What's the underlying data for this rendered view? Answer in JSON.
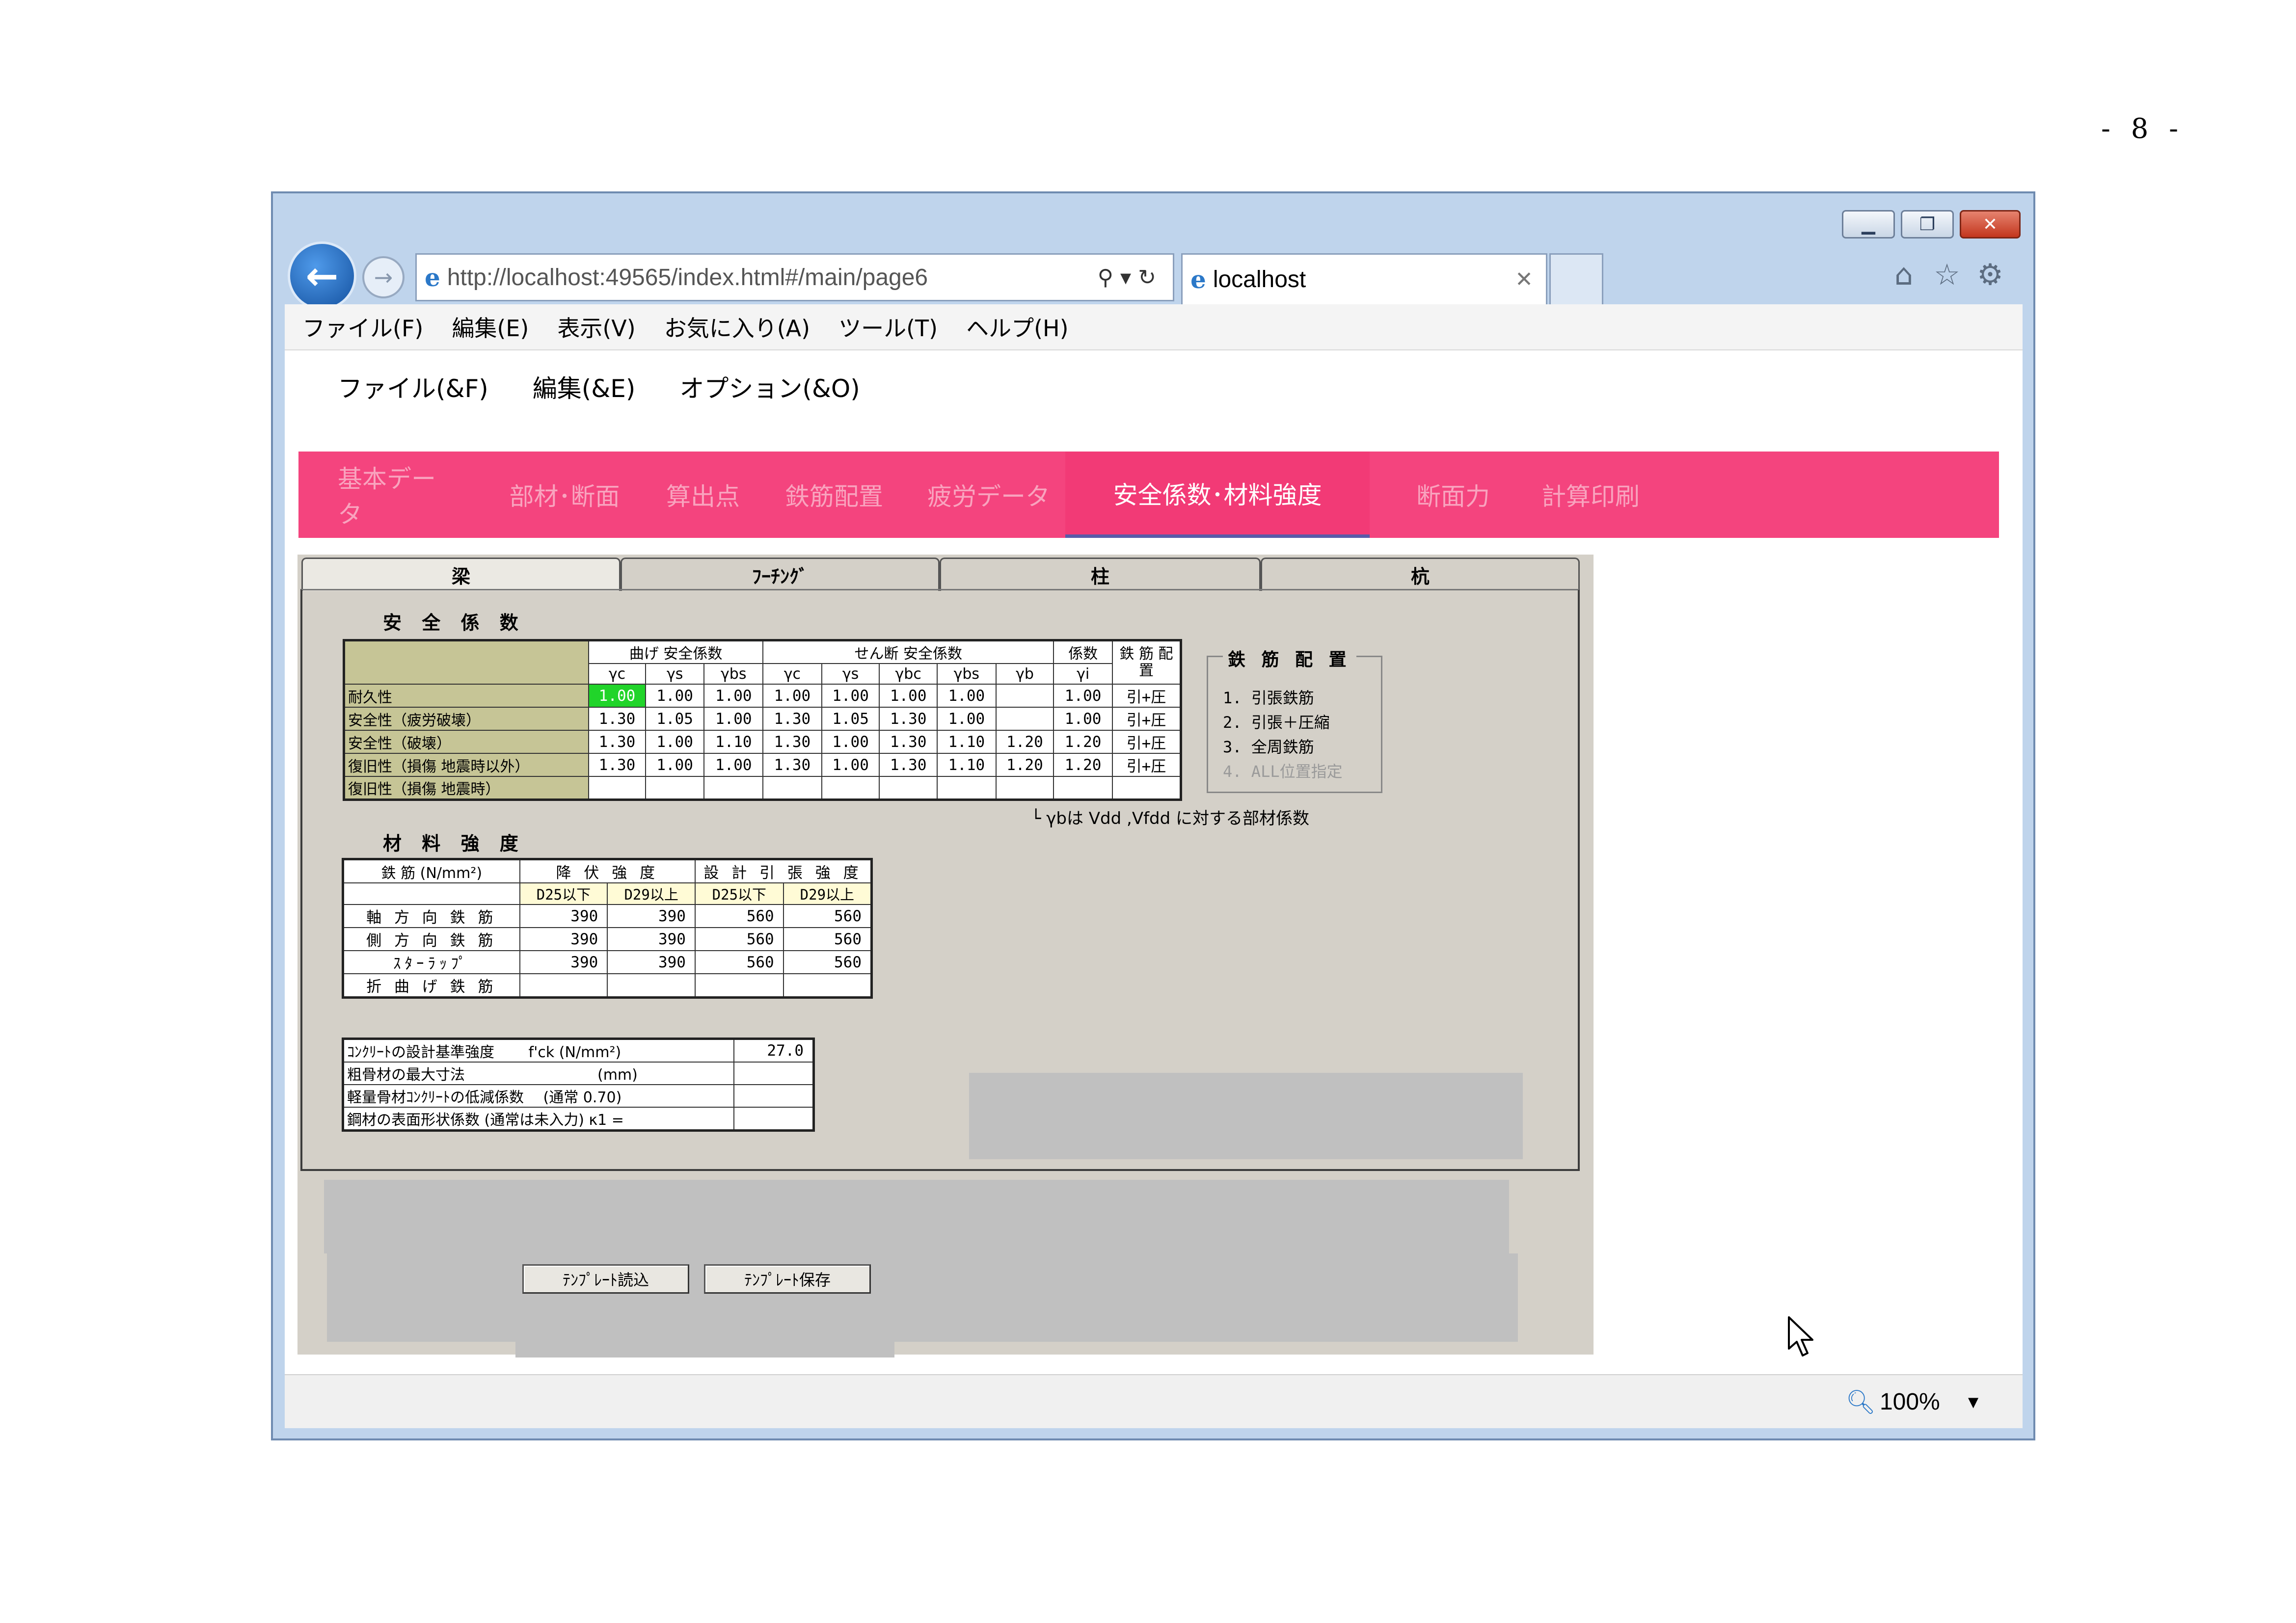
{
  "page_number": "- 8 -",
  "browser": {
    "url": "http://localhost:49565/index.html#/main/page6",
    "tab_title": "localhost",
    "menu": [
      "ファイル(F)",
      "編集(E)",
      "表示(V)",
      "お気に入り(A)",
      "ツール(T)",
      "ヘルプ(H)"
    ],
    "zoom": "100%"
  },
  "app_menu": [
    "ファイル(&F)",
    "編集(&E)",
    "オプション(&O)"
  ],
  "nav": [
    "基本データ",
    "部材･断面",
    "算出点",
    "鉄筋配置",
    "疲労データ",
    "安全係数･材料強度",
    "断面力",
    "計算印刷"
  ],
  "nav_active": 5,
  "panel_tabs": [
    "梁",
    "ﾌｰﾁﾝｸﾞ",
    "柱",
    "杭"
  ],
  "safety": {
    "title": "安 全 係 数",
    "groups": {
      "bending": "曲げ 安全係数",
      "shear": "せん断 安全係数",
      "coef": "係数",
      "rebar": "鉄 筋 配 置"
    },
    "cols": [
      "γc",
      "γs",
      "γbs",
      "γc",
      "γs",
      "γbc",
      "γbs",
      "γb",
      "γi"
    ],
    "rows": [
      {
        "label": "耐久性",
        "vals": [
          "1.00",
          "1.00",
          "1.00",
          "1.00",
          "1.00",
          "1.00",
          "1.00",
          "",
          "1.00"
        ],
        "bar": "引+圧"
      },
      {
        "label": "安全性（疲労破壊）",
        "vals": [
          "1.30",
          "1.05",
          "1.00",
          "1.30",
          "1.05",
          "1.30",
          "1.00",
          "",
          "1.00"
        ],
        "bar": "引+圧"
      },
      {
        "label": "安全性（破壊）",
        "vals": [
          "1.30",
          "1.00",
          "1.10",
          "1.30",
          "1.00",
          "1.30",
          "1.10",
          "1.20",
          "1.20"
        ],
        "bar": "引+圧"
      },
      {
        "label": "復旧性（損傷 地震時以外）",
        "vals": [
          "1.30",
          "1.00",
          "1.00",
          "1.30",
          "1.00",
          "1.30",
          "1.10",
          "1.20",
          "1.20"
        ],
        "bar": "引+圧"
      },
      {
        "label": "復旧性（損傷 地震時）",
        "vals": [
          "",
          "",
          "",
          "",
          "",
          "",
          "",
          "",
          ""
        ],
        "bar": ""
      }
    ],
    "note": "└ γbは Vdd ,Vfdd に対する部材係数"
  },
  "rebar_legend": {
    "title": "鉄 筋 配 置",
    "items": [
      "1. 引張鉄筋",
      "2. 引張＋圧縮",
      "3. 全周鉄筋",
      "4. ALL位置指定"
    ]
  },
  "material": {
    "title": "材 料 強 度",
    "head": {
      "rebar": "鉄 筋 (N/mm²)",
      "yield": "降 伏 強 度",
      "tensile": "設 計 引 張 強 度"
    },
    "sub": [
      "D25以下",
      "D29以上",
      "D25以下",
      "D29以上"
    ],
    "rows": [
      {
        "label": "軸 方 向 鉄 筋",
        "vals": [
          "390",
          "390",
          "560",
          "560"
        ]
      },
      {
        "label": "側 方 向 鉄 筋",
        "vals": [
          "390",
          "390",
          "560",
          "560"
        ]
      },
      {
        "label": "ｽﾀｰﾗｯﾌﾟ",
        "vals": [
          "390",
          "390",
          "560",
          "560"
        ]
      },
      {
        "label": "折 曲 げ 鉄 筋",
        "vals": [
          "",
          "",
          "",
          ""
        ]
      }
    ]
  },
  "concrete": [
    {
      "label": "ｺﾝｸﾘｰﾄの設計基準強度　　 f'ck (N/mm²)",
      "value": "27.0"
    },
    {
      "label": "粗骨材の最大寸法　　　　　　　　　(mm)",
      "value": ""
    },
    {
      "label": "軽量骨材ｺﾝｸﾘｰﾄの低減係数　 (通常 0.70)",
      "value": ""
    },
    {
      "label": "鋼材の表面形状係数 (通常は未入力) κ1 =",
      "value": ""
    }
  ],
  "buttons": {
    "load": "ﾃﾝﾌﾟﾚｰﾄ読込",
    "save": "ﾃﾝﾌﾟﾚｰﾄ保存"
  },
  "colors": {
    "nav_bg": "#f4447e",
    "nav_active_border": "#5a5aa8",
    "highlight_cell": "#21d42a",
    "label_cell": "#c6c596"
  }
}
